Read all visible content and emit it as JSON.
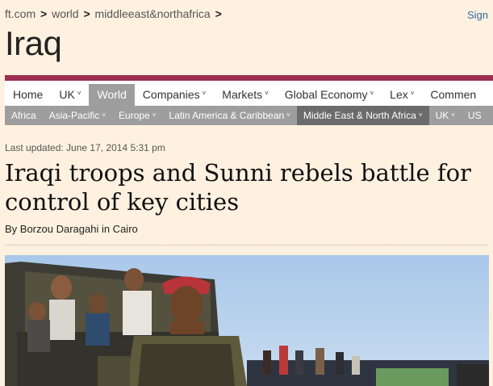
{
  "breadcrumb": {
    "items": [
      "ft.com",
      "world",
      "middleeast&northafrica"
    ],
    "separator": ">"
  },
  "sign_in": "Sign",
  "section_title": "Iraq",
  "nav_primary": {
    "items": [
      {
        "label": "Home",
        "caret": ""
      },
      {
        "label": "UK",
        "caret": "˅"
      },
      {
        "label": "World",
        "caret": ""
      },
      {
        "label": "Companies",
        "caret": "˅"
      },
      {
        "label": "Markets",
        "caret": "˅"
      },
      {
        "label": "Global Economy",
        "caret": "˅"
      },
      {
        "label": "Lex",
        "caret": "˅"
      },
      {
        "label": "Commen",
        "caret": ""
      }
    ],
    "active": "World"
  },
  "nav_secondary": {
    "items": [
      {
        "label": "Africa",
        "caret": ""
      },
      {
        "label": "Asia-Pacific",
        "caret": "˅"
      },
      {
        "label": "Europe",
        "caret": "˅"
      },
      {
        "label": "Latin America & Caribbean",
        "caret": "˅"
      },
      {
        "label": "Middle East & North Africa",
        "caret": "˅"
      },
      {
        "label": "UK",
        "caret": "˅"
      },
      {
        "label": "US",
        "caret": ""
      }
    ],
    "active": "Middle East & North Africa"
  },
  "article": {
    "last_updated": "Last updated: June 17, 2014 5:31 pm",
    "headline": "Iraqi troops and Sunni rebels battle for control of key cities",
    "byline": "By Borzou Daragahi in Cairo"
  },
  "colors": {
    "page_bg": "#fff1e0",
    "accent_bar": "#9e2f50",
    "nav_active": "#9e9e9e",
    "subnav_bg": "#9e9e9e",
    "subnav_active": "#6b6b6b",
    "link": "#2e6e9e"
  }
}
